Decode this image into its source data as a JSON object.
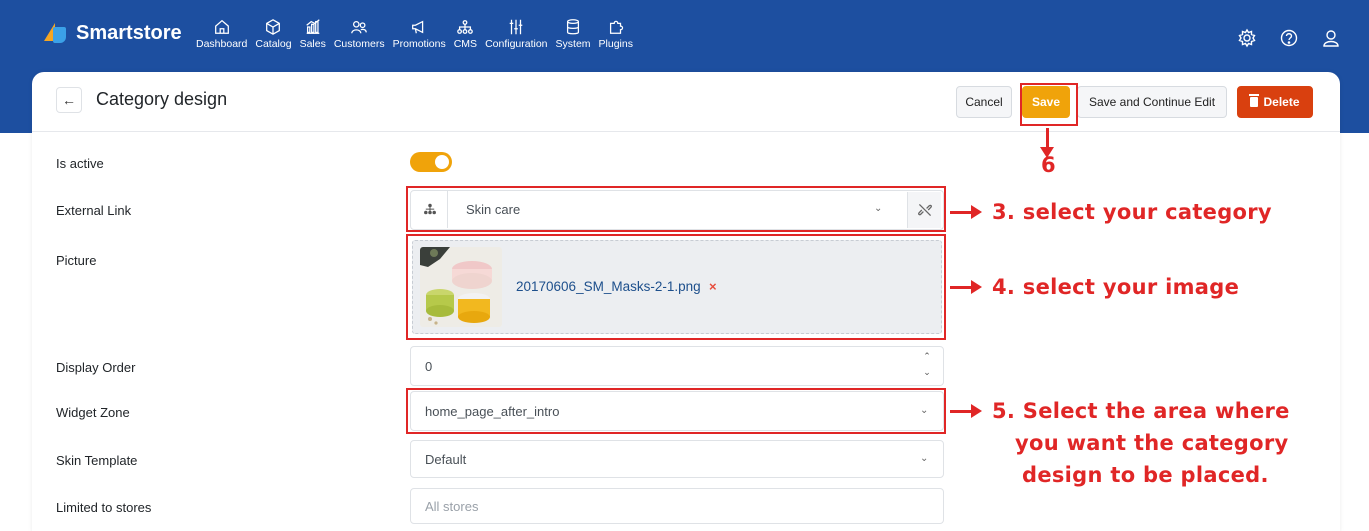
{
  "app": {
    "brand": "Smartstore"
  },
  "nav": {
    "items": [
      {
        "label": "Dashboard",
        "icon": "home-icon"
      },
      {
        "label": "Catalog",
        "icon": "box-icon"
      },
      {
        "label": "Sales",
        "icon": "chart-icon"
      },
      {
        "label": "Customers",
        "icon": "users-icon"
      },
      {
        "label": "Promotions",
        "icon": "megaphone-icon"
      },
      {
        "label": "CMS",
        "icon": "sitemap-icon"
      },
      {
        "label": "Configuration",
        "icon": "sliders-icon"
      },
      {
        "label": "System",
        "icon": "database-icon"
      },
      {
        "label": "Plugins",
        "icon": "puzzle-icon"
      }
    ]
  },
  "page": {
    "title": "Category design",
    "buttons": {
      "cancel": "Cancel",
      "save": "Save",
      "save_continue": "Save and Continue Edit",
      "delete": "Delete"
    }
  },
  "form": {
    "is_active": {
      "label": "Is active",
      "value": true
    },
    "external_link": {
      "label": "External Link",
      "value": "Skin care"
    },
    "picture": {
      "label": "Picture",
      "filename": "20170606_SM_Masks-2-1.png",
      "remove": "×"
    },
    "display_order": {
      "label": "Display Order",
      "value": "0"
    },
    "widget_zone": {
      "label": "Widget Zone",
      "value": "home_page_after_intro"
    },
    "skin_template": {
      "label": "Skin Template",
      "value": "Default"
    },
    "limited_to_stores": {
      "label": "Limited to stores",
      "placeholder": "All stores"
    }
  },
  "annotations": {
    "save_step": "6",
    "step3": "3. select your category",
    "step4": "4. select your image",
    "step5_line1": "5. Select the area where",
    "step5_line2": "you want the category",
    "step5_line3": "design to be placed."
  },
  "colors": {
    "topbar": "#1d4fa0",
    "accent": "#f0a30a",
    "danger": "#d9400f",
    "annotation": "#e02626"
  }
}
